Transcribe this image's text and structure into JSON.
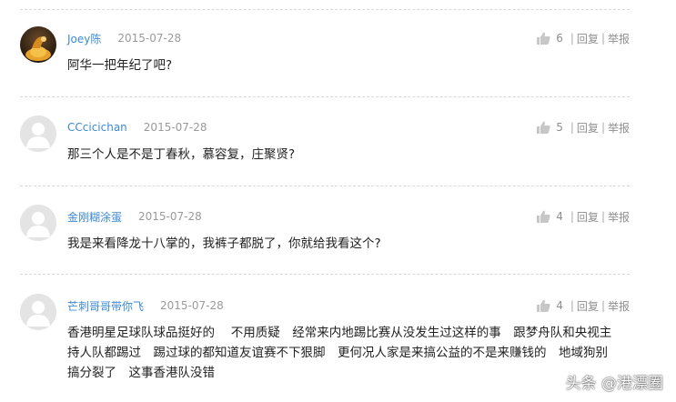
{
  "comments": [
    {
      "username": "Joey陈",
      "date": "2015-07-28",
      "likes": "6",
      "reply_label": "回复",
      "report_label": "举报",
      "text": "阿华一把年纪了吧?",
      "avatar": "custom"
    },
    {
      "username": "CCcicichan",
      "date": "2015-07-28",
      "likes": "5",
      "reply_label": "回复",
      "report_label": "举报",
      "text": "那三个人是不是丁春秋，慕容复，庄聚贤?",
      "avatar": "default"
    },
    {
      "username": "金刚糊涂蛋",
      "date": "2015-07-28",
      "likes": "4",
      "reply_label": "回复",
      "report_label": "举报",
      "text": "我是来看降龙十八掌的，我裤子都脱了，你就给我看这个?",
      "avatar": "default"
    },
    {
      "username": "芒刺哥哥带你飞",
      "date": "2015-07-28",
      "likes": "4",
      "reply_label": "回复",
      "report_label": "举报",
      "text_lines": [
        "香港明星足球队球品挺好的　 不用质疑　经常来内地踢比赛从没发生过这样的事　跟梦舟队和央视主",
        "持人队都踢过　踢过球的都知道友谊赛不下狠脚　更何况人家是来搞公益的不是来赚钱的　地域狗别",
        "搞分裂了　这事香港队没错"
      ],
      "avatar": "default"
    }
  ],
  "separator": "|",
  "watermark": "头条 @港漂圈",
  "colors": {
    "username": "#3d8ad6",
    "meta_gray": "#9a9a9a",
    "divider": "#d9d9d9"
  }
}
